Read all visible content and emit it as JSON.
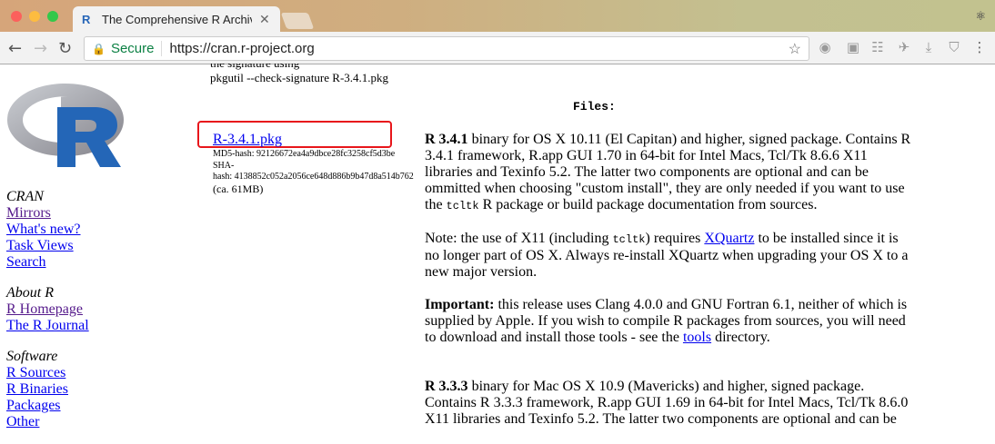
{
  "browser": {
    "tab_title": "The Comprehensive R Archive",
    "secure_label": "Secure",
    "url": "https://cran.r-project.org",
    "colors": {
      "close": "#fc605c",
      "minimize": "#fdbc40",
      "zoom": "#34c84a"
    }
  },
  "logo_text": "R",
  "sidebar": {
    "sections": [
      {
        "heading": "CRAN",
        "links": [
          "Mirrors",
          "What's new?",
          "Task Views",
          "Search"
        ]
      },
      {
        "heading": "About R",
        "links": [
          "R Homepage",
          "The R Journal"
        ]
      },
      {
        "heading": "Software",
        "links": [
          "R Sources",
          "R Binaries",
          "Packages",
          "Other"
        ]
      }
    ]
  },
  "main": {
    "pre_partial": "the signature using",
    "pre_command": "pkgutil --check-signature R-3.4.1.pkg",
    "files_heading": "Files:",
    "download": {
      "link": "R-3.4.1.pkg",
      "md5": "MD5-hash: 92126672ea4a9dbce28fc3258cf5d3be",
      "sha_label": "SHA-",
      "sha": "hash: 4138852c052a2056ce648d886b9b47d8a514b762",
      "size": "(ca. 61MB)"
    },
    "desc1": {
      "bold": "R 3.4.1",
      "text1": " binary for OS X 10.11 (El Capitan) and higher, signed package. Contains R 3.4.1 framework, R.app GUI 1.70 in 64-bit for Intel Macs, Tcl/Tk 8.6.6 X11 libraries and Texinfo 5.2. The latter two components are optional and can be ommitted when choosing \"custom install\", they are only needed if you want to use the ",
      "code": "tcltk",
      "text2": " R package or build package documentation from sources."
    },
    "note": {
      "text1": "Note: the use of X11 (including ",
      "code": "tcltk",
      "text2": ") requires ",
      "link": "XQuartz",
      "text3": " to be installed since it is no longer part of OS X. Always re-install XQuartz when upgrading your OS X to a new major version."
    },
    "important": {
      "bold": "Important:",
      "text1": " this release uses Clang 4.0.0 and GNU Fortran 6.1, neither of which is supplied by Apple. If you wish to compile R packages from sources, you will need to download and install those tools - see the ",
      "link": "tools",
      "text2": " directory."
    },
    "desc2": {
      "bold": "R 3.3.3",
      "text1": " binary for Mac OS X 10.9 (Mavericks) and higher, signed package. Contains R 3.3.3 framework, R.app GUI 1.69 in 64-bit for Intel Macs, Tcl/Tk 8.6.0 X11 libraries and Texinfo 5.2. The latter two components are optional and can be"
    }
  }
}
